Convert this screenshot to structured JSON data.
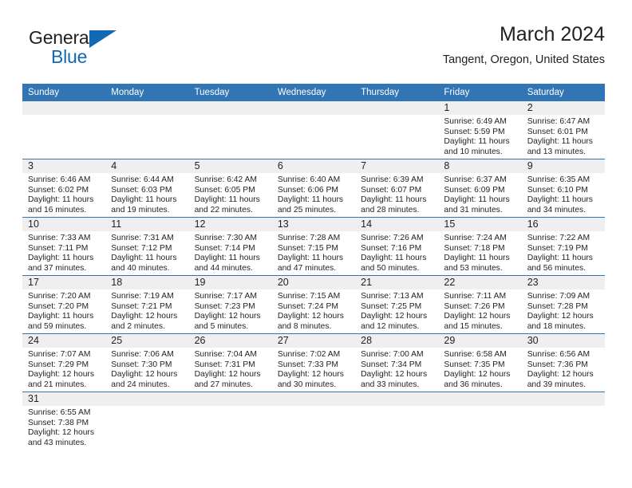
{
  "brand": {
    "name_part1": "General",
    "name_part2": "Blue",
    "triangle_icon": "blue-triangle-logo-mark",
    "color_dark": "#231f20",
    "color_blue": "#1268b3"
  },
  "header": {
    "title": "March 2024",
    "subtitle": "Tangent, Oregon, United States"
  },
  "theme": {
    "header_blue": "#3175b4",
    "row_separator_blue": "#3175b4",
    "daynum_band_gray": "#efefef",
    "text_color": "#231f20"
  },
  "weekday_headers": [
    "Sunday",
    "Monday",
    "Tuesday",
    "Wednesday",
    "Thursday",
    "Friday",
    "Saturday"
  ],
  "weeks": [
    [
      {
        "day": "",
        "sunrise": "",
        "sunset": "",
        "daylight_line1": "",
        "daylight_line2": ""
      },
      {
        "day": "",
        "sunrise": "",
        "sunset": "",
        "daylight_line1": "",
        "daylight_line2": ""
      },
      {
        "day": "",
        "sunrise": "",
        "sunset": "",
        "daylight_line1": "",
        "daylight_line2": ""
      },
      {
        "day": "",
        "sunrise": "",
        "sunset": "",
        "daylight_line1": "",
        "daylight_line2": ""
      },
      {
        "day": "",
        "sunrise": "",
        "sunset": "",
        "daylight_line1": "",
        "daylight_line2": ""
      },
      {
        "day": "1",
        "sunrise": "Sunrise: 6:49 AM",
        "sunset": "Sunset: 5:59 PM",
        "daylight_line1": "Daylight: 11 hours",
        "daylight_line2": "and 10 minutes."
      },
      {
        "day": "2",
        "sunrise": "Sunrise: 6:47 AM",
        "sunset": "Sunset: 6:01 PM",
        "daylight_line1": "Daylight: 11 hours",
        "daylight_line2": "and 13 minutes."
      }
    ],
    [
      {
        "day": "3",
        "sunrise": "Sunrise: 6:46 AM",
        "sunset": "Sunset: 6:02 PM",
        "daylight_line1": "Daylight: 11 hours",
        "daylight_line2": "and 16 minutes."
      },
      {
        "day": "4",
        "sunrise": "Sunrise: 6:44 AM",
        "sunset": "Sunset: 6:03 PM",
        "daylight_line1": "Daylight: 11 hours",
        "daylight_line2": "and 19 minutes."
      },
      {
        "day": "5",
        "sunrise": "Sunrise: 6:42 AM",
        "sunset": "Sunset: 6:05 PM",
        "daylight_line1": "Daylight: 11 hours",
        "daylight_line2": "and 22 minutes."
      },
      {
        "day": "6",
        "sunrise": "Sunrise: 6:40 AM",
        "sunset": "Sunset: 6:06 PM",
        "daylight_line1": "Daylight: 11 hours",
        "daylight_line2": "and 25 minutes."
      },
      {
        "day": "7",
        "sunrise": "Sunrise: 6:39 AM",
        "sunset": "Sunset: 6:07 PM",
        "daylight_line1": "Daylight: 11 hours",
        "daylight_line2": "and 28 minutes."
      },
      {
        "day": "8",
        "sunrise": "Sunrise: 6:37 AM",
        "sunset": "Sunset: 6:09 PM",
        "daylight_line1": "Daylight: 11 hours",
        "daylight_line2": "and 31 minutes."
      },
      {
        "day": "9",
        "sunrise": "Sunrise: 6:35 AM",
        "sunset": "Sunset: 6:10 PM",
        "daylight_line1": "Daylight: 11 hours",
        "daylight_line2": "and 34 minutes."
      }
    ],
    [
      {
        "day": "10",
        "sunrise": "Sunrise: 7:33 AM",
        "sunset": "Sunset: 7:11 PM",
        "daylight_line1": "Daylight: 11 hours",
        "daylight_line2": "and 37 minutes."
      },
      {
        "day": "11",
        "sunrise": "Sunrise: 7:31 AM",
        "sunset": "Sunset: 7:12 PM",
        "daylight_line1": "Daylight: 11 hours",
        "daylight_line2": "and 40 minutes."
      },
      {
        "day": "12",
        "sunrise": "Sunrise: 7:30 AM",
        "sunset": "Sunset: 7:14 PM",
        "daylight_line1": "Daylight: 11 hours",
        "daylight_line2": "and 44 minutes."
      },
      {
        "day": "13",
        "sunrise": "Sunrise: 7:28 AM",
        "sunset": "Sunset: 7:15 PM",
        "daylight_line1": "Daylight: 11 hours",
        "daylight_line2": "and 47 minutes."
      },
      {
        "day": "14",
        "sunrise": "Sunrise: 7:26 AM",
        "sunset": "Sunset: 7:16 PM",
        "daylight_line1": "Daylight: 11 hours",
        "daylight_line2": "and 50 minutes."
      },
      {
        "day": "15",
        "sunrise": "Sunrise: 7:24 AM",
        "sunset": "Sunset: 7:18 PM",
        "daylight_line1": "Daylight: 11 hours",
        "daylight_line2": "and 53 minutes."
      },
      {
        "day": "16",
        "sunrise": "Sunrise: 7:22 AM",
        "sunset": "Sunset: 7:19 PM",
        "daylight_line1": "Daylight: 11 hours",
        "daylight_line2": "and 56 minutes."
      }
    ],
    [
      {
        "day": "17",
        "sunrise": "Sunrise: 7:20 AM",
        "sunset": "Sunset: 7:20 PM",
        "daylight_line1": "Daylight: 11 hours",
        "daylight_line2": "and 59 minutes."
      },
      {
        "day": "18",
        "sunrise": "Sunrise: 7:19 AM",
        "sunset": "Sunset: 7:21 PM",
        "daylight_line1": "Daylight: 12 hours",
        "daylight_line2": "and 2 minutes."
      },
      {
        "day": "19",
        "sunrise": "Sunrise: 7:17 AM",
        "sunset": "Sunset: 7:23 PM",
        "daylight_line1": "Daylight: 12 hours",
        "daylight_line2": "and 5 minutes."
      },
      {
        "day": "20",
        "sunrise": "Sunrise: 7:15 AM",
        "sunset": "Sunset: 7:24 PM",
        "daylight_line1": "Daylight: 12 hours",
        "daylight_line2": "and 8 minutes."
      },
      {
        "day": "21",
        "sunrise": "Sunrise: 7:13 AM",
        "sunset": "Sunset: 7:25 PM",
        "daylight_line1": "Daylight: 12 hours",
        "daylight_line2": "and 12 minutes."
      },
      {
        "day": "22",
        "sunrise": "Sunrise: 7:11 AM",
        "sunset": "Sunset: 7:26 PM",
        "daylight_line1": "Daylight: 12 hours",
        "daylight_line2": "and 15 minutes."
      },
      {
        "day": "23",
        "sunrise": "Sunrise: 7:09 AM",
        "sunset": "Sunset: 7:28 PM",
        "daylight_line1": "Daylight: 12 hours",
        "daylight_line2": "and 18 minutes."
      }
    ],
    [
      {
        "day": "24",
        "sunrise": "Sunrise: 7:07 AM",
        "sunset": "Sunset: 7:29 PM",
        "daylight_line1": "Daylight: 12 hours",
        "daylight_line2": "and 21 minutes."
      },
      {
        "day": "25",
        "sunrise": "Sunrise: 7:06 AM",
        "sunset": "Sunset: 7:30 PM",
        "daylight_line1": "Daylight: 12 hours",
        "daylight_line2": "and 24 minutes."
      },
      {
        "day": "26",
        "sunrise": "Sunrise: 7:04 AM",
        "sunset": "Sunset: 7:31 PM",
        "daylight_line1": "Daylight: 12 hours",
        "daylight_line2": "and 27 minutes."
      },
      {
        "day": "27",
        "sunrise": "Sunrise: 7:02 AM",
        "sunset": "Sunset: 7:33 PM",
        "daylight_line1": "Daylight: 12 hours",
        "daylight_line2": "and 30 minutes."
      },
      {
        "day": "28",
        "sunrise": "Sunrise: 7:00 AM",
        "sunset": "Sunset: 7:34 PM",
        "daylight_line1": "Daylight: 12 hours",
        "daylight_line2": "and 33 minutes."
      },
      {
        "day": "29",
        "sunrise": "Sunrise: 6:58 AM",
        "sunset": "Sunset: 7:35 PM",
        "daylight_line1": "Daylight: 12 hours",
        "daylight_line2": "and 36 minutes."
      },
      {
        "day": "30",
        "sunrise": "Sunrise: 6:56 AM",
        "sunset": "Sunset: 7:36 PM",
        "daylight_line1": "Daylight: 12 hours",
        "daylight_line2": "and 39 minutes."
      }
    ],
    [
      {
        "day": "31",
        "sunrise": "Sunrise: 6:55 AM",
        "sunset": "Sunset: 7:38 PM",
        "daylight_line1": "Daylight: 12 hours",
        "daylight_line2": "and 43 minutes."
      },
      {
        "day": "",
        "sunrise": "",
        "sunset": "",
        "daylight_line1": "",
        "daylight_line2": ""
      },
      {
        "day": "",
        "sunrise": "",
        "sunset": "",
        "daylight_line1": "",
        "daylight_line2": ""
      },
      {
        "day": "",
        "sunrise": "",
        "sunset": "",
        "daylight_line1": "",
        "daylight_line2": ""
      },
      {
        "day": "",
        "sunrise": "",
        "sunset": "",
        "daylight_line1": "",
        "daylight_line2": ""
      },
      {
        "day": "",
        "sunrise": "",
        "sunset": "",
        "daylight_line1": "",
        "daylight_line2": ""
      },
      {
        "day": "",
        "sunrise": "",
        "sunset": "",
        "daylight_line1": "",
        "daylight_line2": ""
      }
    ]
  ]
}
